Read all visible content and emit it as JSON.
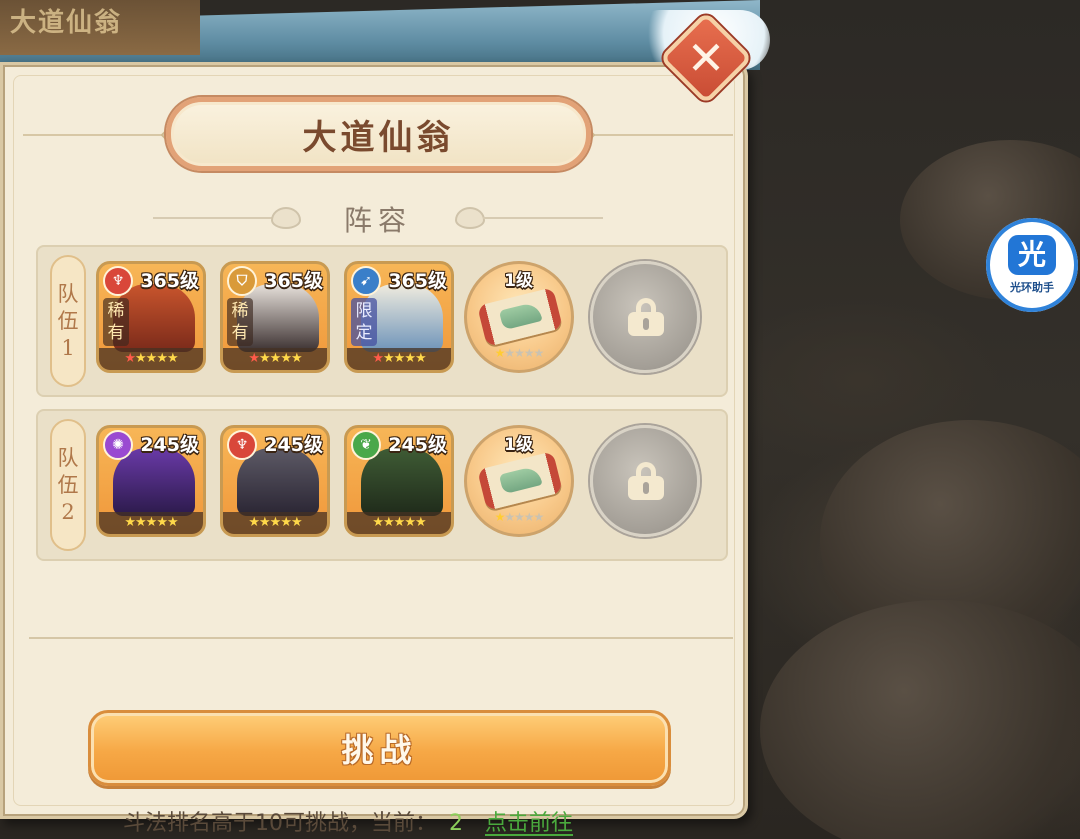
{
  "background": {
    "top_left_text": "大道仙翁"
  },
  "dialog": {
    "title": "大道仙翁",
    "subtitle": "阵容",
    "close_icon": "close-x-icon"
  },
  "teams": [
    {
      "tag": [
        "队",
        "伍",
        "1"
      ],
      "slots": [
        {
          "type": "hero",
          "level": "365级",
          "element": "fire",
          "element_color": "#d9473a",
          "rarity": [
            "稀",
            "有"
          ],
          "stars": {
            "red": 1,
            "gold": 4
          },
          "portrait_colors": [
            "#c9552d",
            "#7a2a1a"
          ]
        },
        {
          "type": "hero",
          "level": "365级",
          "element": "shield",
          "element_color": "#d99a3a",
          "rarity": [
            "稀",
            "有"
          ],
          "stars": {
            "red": 1,
            "gold": 4
          },
          "portrait_colors": [
            "#e8e2dc",
            "#3a2f2f"
          ]
        },
        {
          "type": "hero",
          "level": "365级",
          "element": "bow",
          "element_color": "#3a7fc9",
          "rarity": [
            "限",
            "定"
          ],
          "rarity_limited": true,
          "stars": {
            "red": 1,
            "gold": 4
          },
          "portrait_colors": [
            "#f0ecdf",
            "#6d93b9"
          ]
        },
        {
          "type": "item",
          "level": "1级",
          "stars": {
            "gold": 1,
            "grey": 4
          }
        },
        {
          "type": "lock"
        }
      ]
    },
    {
      "tag": [
        "队",
        "伍",
        "2"
      ],
      "slots": [
        {
          "type": "hero",
          "level": "245级",
          "element": "magic",
          "element_color": "#9a4ad1",
          "stars": {
            "red": 0,
            "gold": 5
          },
          "portrait_colors": [
            "#6a3aa8",
            "#2b1a4a"
          ]
        },
        {
          "type": "hero",
          "level": "245级",
          "element": "fire",
          "element_color": "#d9473a",
          "stars": {
            "red": 0,
            "gold": 5
          },
          "portrait_colors": [
            "#5d5a66",
            "#2a2533"
          ]
        },
        {
          "type": "hero",
          "level": "245级",
          "element": "nature",
          "element_color": "#4aa84a",
          "stars": {
            "red": 0,
            "gold": 5
          },
          "portrait_colors": [
            "#3f5c35",
            "#1f2a1a"
          ]
        },
        {
          "type": "item",
          "level": "1级",
          "stars": {
            "gold": 1,
            "grey": 4
          }
        },
        {
          "type": "lock"
        }
      ]
    }
  ],
  "challenge_button": "挑战",
  "requirement": {
    "text": "斗法排名高于10可挑战，当前：",
    "current": "2",
    "link": "点击前往"
  },
  "assistant": {
    "logo": "光",
    "label": "光环助手"
  }
}
